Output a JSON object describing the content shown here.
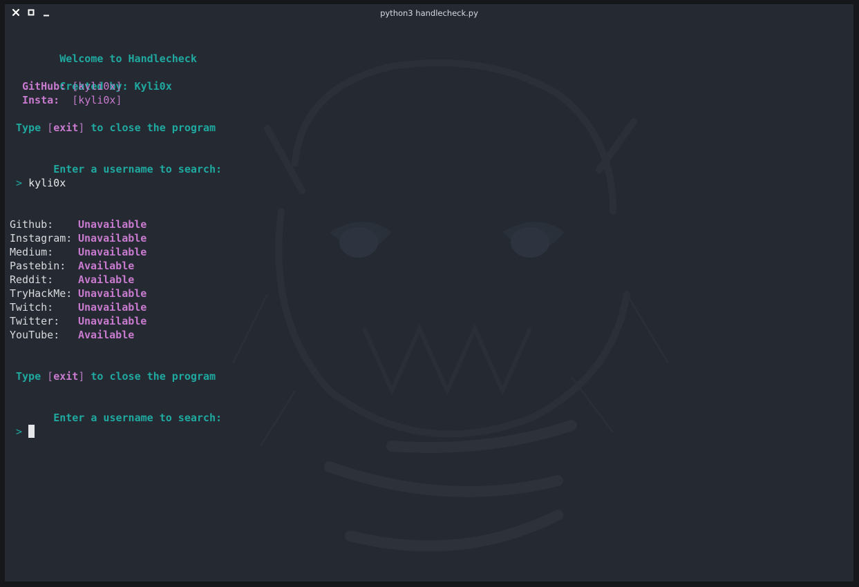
{
  "window": {
    "title": "python3 handlecheck.py"
  },
  "banner": {
    "welcome": "Welcome to Handlecheck",
    "created_by": "Created by: Kyli0x",
    "github_label": "GitHub:",
    "github_value": "kyli0x",
    "insta_label": "Insta:",
    "insta_value": "kyli0x"
  },
  "prompt": {
    "exit_prefix": "Type ",
    "exit_word": "exit",
    "exit_suffix": " to close the program",
    "enter_username": "Enter a username to search:",
    "caret": ">",
    "first_input": "kyli0x"
  },
  "results": [
    {
      "site": "Github:",
      "status": "Unavailable"
    },
    {
      "site": "Instagram:",
      "status": "Unavailable"
    },
    {
      "site": "Medium:",
      "status": "Unavailable"
    },
    {
      "site": "Pastebin:",
      "status": "Available"
    },
    {
      "site": "Reddit:",
      "status": "Available"
    },
    {
      "site": "TryHackMe:",
      "status": "Unavailable"
    },
    {
      "site": "Twitch:",
      "status": "Unavailable"
    },
    {
      "site": "Twitter:",
      "status": "Unavailable"
    },
    {
      "site": "YouTube:",
      "status": "Available"
    }
  ],
  "colors": {
    "terminal_bg": "#252931",
    "teal": "#1fa9a0",
    "magenta": "#c97bd0",
    "text": "#d8dadd"
  },
  "icons": {
    "close": "close-icon",
    "maximize": "maximize-icon",
    "minimize": "minimize-icon"
  }
}
